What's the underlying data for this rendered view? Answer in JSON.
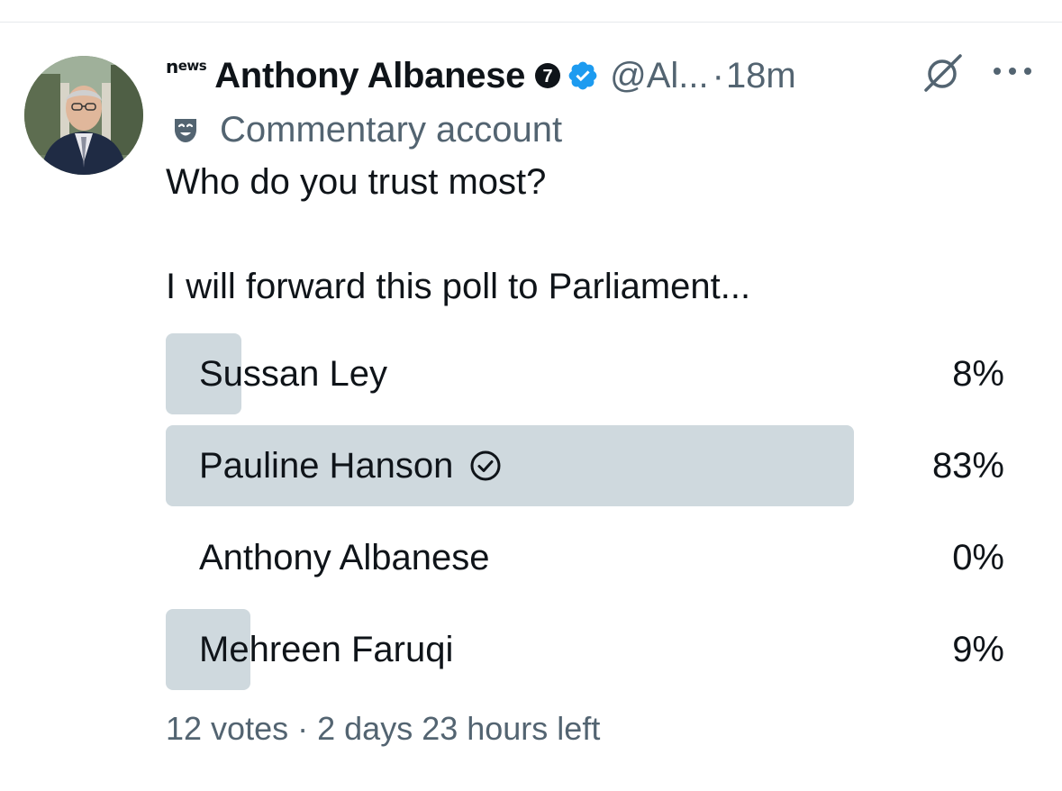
{
  "author": {
    "news_logo": {
      "n": "n",
      "ews": "ews"
    },
    "display_name": "Anthony Albanese",
    "badge_number": "7",
    "handle": "@Al...",
    "separator": "·",
    "time": "18m",
    "commentary_label": "Commentary account"
  },
  "tweet": {
    "line1": "Who do you trust most?",
    "line2": "I will forward this poll to Parliament..."
  },
  "poll": {
    "options": [
      {
        "label": "Sussan Ley",
        "percent_text": "8%",
        "percent": 8,
        "winner": false
      },
      {
        "label": "Pauline Hanson",
        "percent_text": "83%",
        "percent": 83,
        "winner": true
      },
      {
        "label": "Anthony Albanese",
        "percent_text": "0%",
        "percent": 0,
        "winner": false
      },
      {
        "label": "Mehreen Faruqi",
        "percent_text": "9%",
        "percent": 9,
        "winner": false
      }
    ],
    "votes": "12 votes",
    "meta_separator": "·",
    "time_left": "2 days 23 hours left"
  },
  "icons": {
    "badge_7": "number-7-badge-icon",
    "verified": "verified-check-icon",
    "grok": "grok-icon",
    "more": "more-dots-icon",
    "commentary": "theater-mask-icon",
    "winner_check": "check-circle-icon"
  },
  "colors": {
    "text": "#0f1419",
    "secondary": "#536471",
    "verified": "#1d9bf0",
    "poll_bar": "#cfd9de"
  }
}
